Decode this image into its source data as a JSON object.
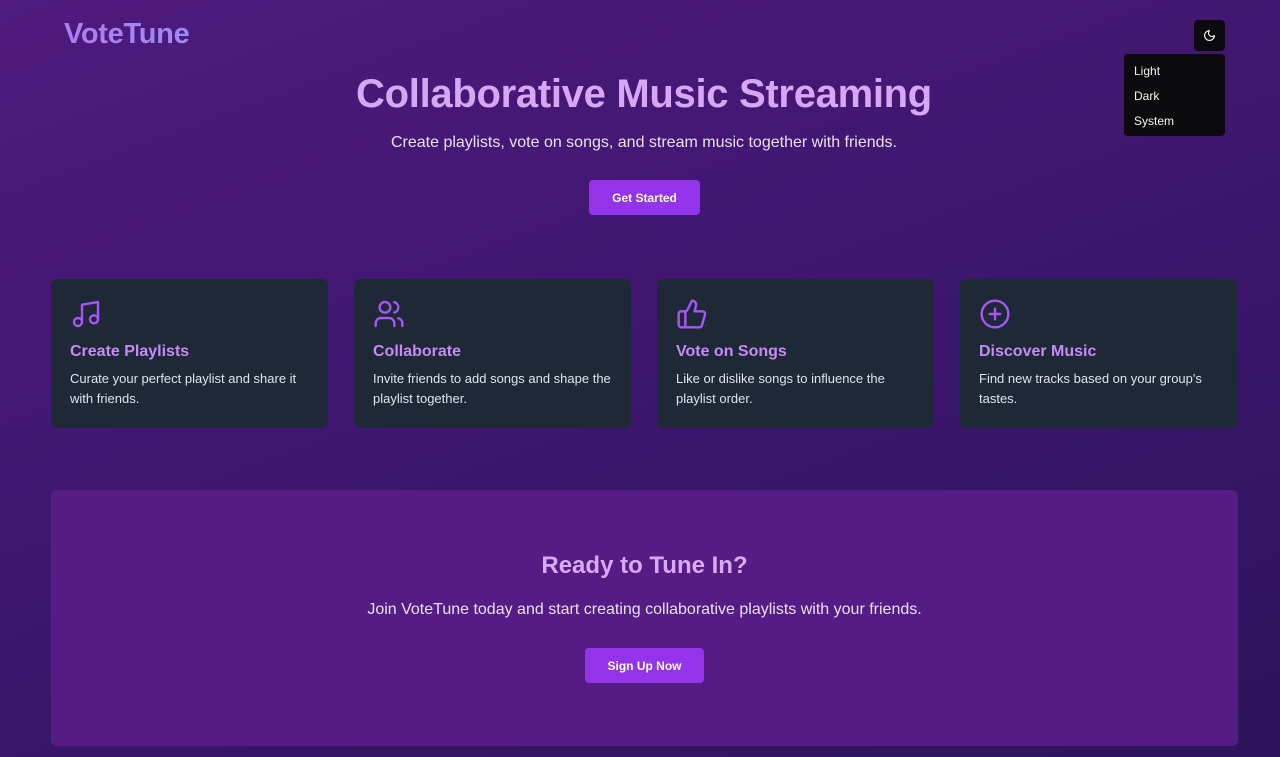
{
  "header": {
    "logo": "VoteTune"
  },
  "theme_menu": {
    "toggle_icon": "moon-icon",
    "items": [
      {
        "label": "Light"
      },
      {
        "label": "Dark"
      },
      {
        "label": "System"
      }
    ]
  },
  "hero": {
    "title": "Collaborative Music Streaming",
    "subtitle": "Create playlists, vote on songs, and stream music together with friends.",
    "button_label": "Get Started"
  },
  "features": [
    {
      "icon": "music-note-icon",
      "title": "Create Playlists",
      "description": "Curate your perfect playlist and share it with friends."
    },
    {
      "icon": "users-icon",
      "title": "Collaborate",
      "description": "Invite friends to add songs and shape the playlist together."
    },
    {
      "icon": "thumbs-up-icon",
      "title": "Vote on Songs",
      "description": "Like or dislike songs to influence the playlist order."
    },
    {
      "icon": "plus-circle-icon",
      "title": "Discover Music",
      "description": "Find new tracks based on your group's tastes."
    }
  ],
  "cta": {
    "title": "Ready to Tune In?",
    "subtitle": "Join VoteTune today and start creating collaborative playlists with your friends.",
    "button_label": "Sign Up Now"
  },
  "colors": {
    "accent": "#9333ea",
    "card_bg": "#1f2837",
    "cta_bg": "#561c86",
    "icon_color": "#a855f7"
  }
}
